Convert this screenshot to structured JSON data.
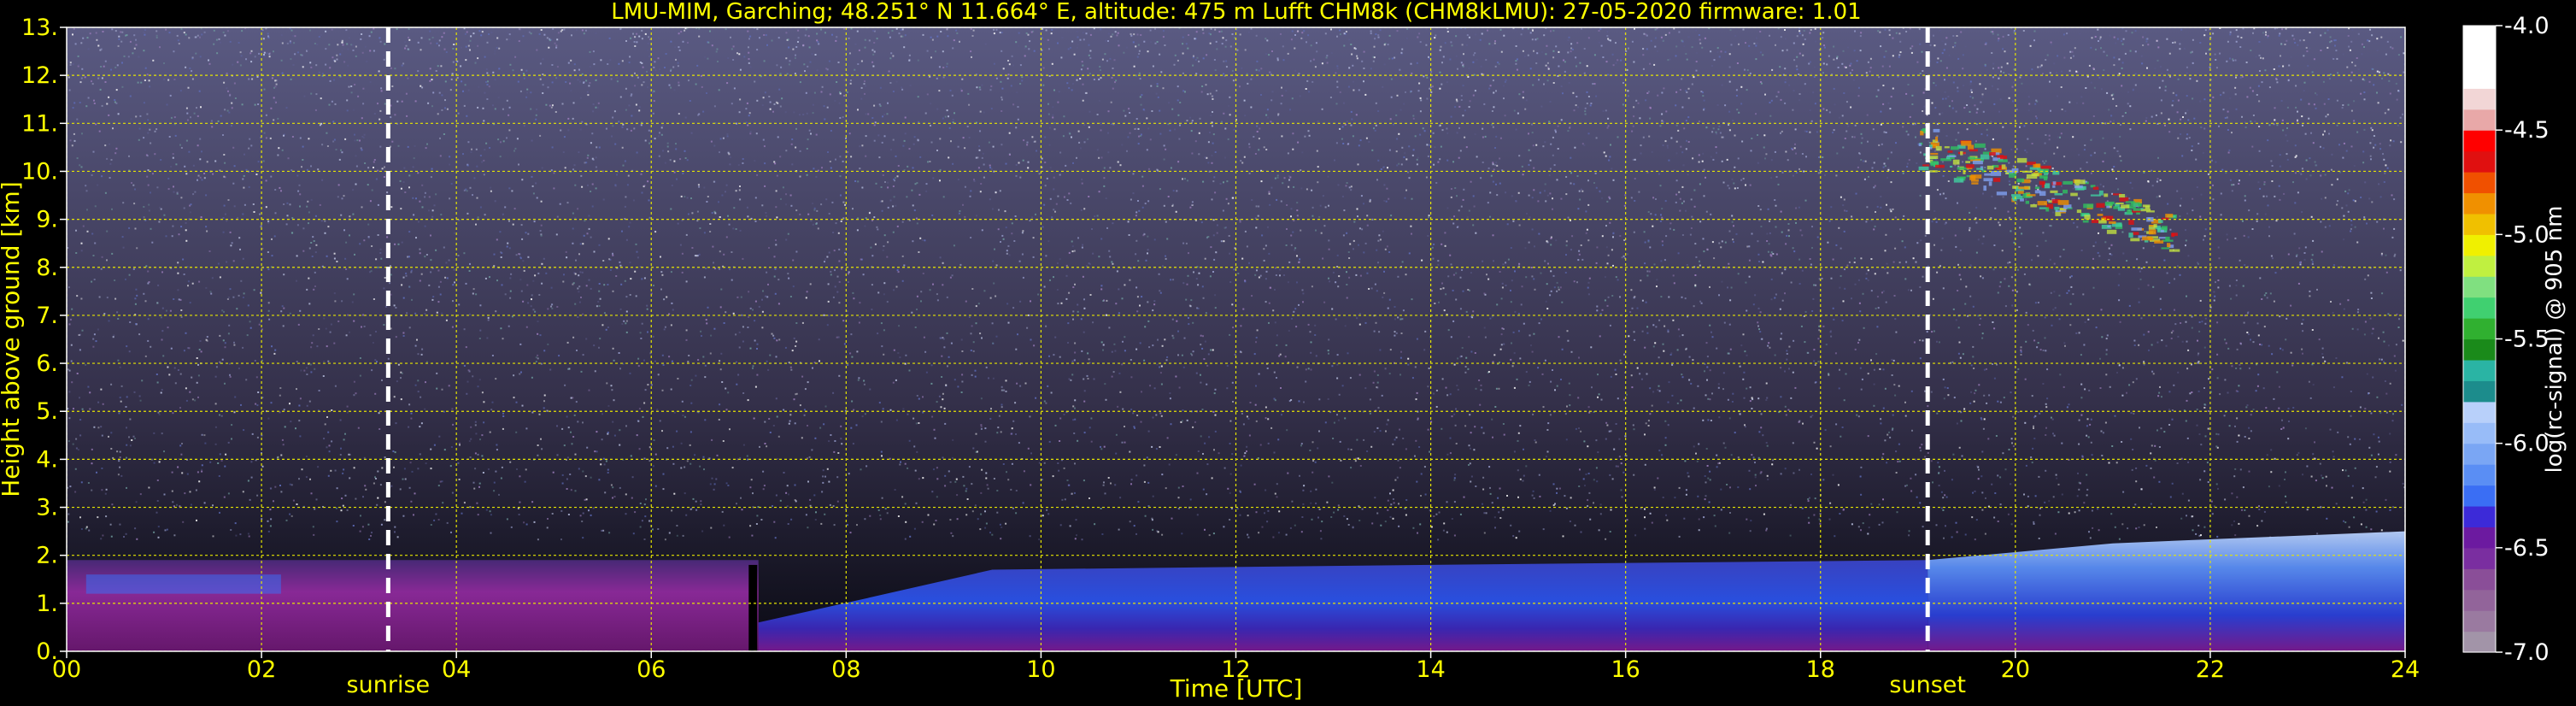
{
  "chart_data": {
    "type": "heatmap",
    "title": "LMU-MIM, Garching; 48.251° N 11.664° E, altitude: 475 m    Lufft CHM8k (CHM8kLMU): 27-05-2020    firmware: 1.01",
    "xlabel": "Time [UTC]",
    "ylabel": "Height above ground [km]",
    "xlim": [
      0,
      24
    ],
    "ylim": [
      0,
      13
    ],
    "x_ticks": [
      "00",
      "02",
      "04",
      "06",
      "08",
      "10",
      "12",
      "14",
      "16",
      "18",
      "20",
      "22",
      "24"
    ],
    "y_ticks": [
      "0.",
      "1.",
      "2.",
      "3.",
      "4.",
      "5.",
      "6.",
      "7.",
      "8.",
      "9.",
      "10.",
      "11.",
      "12.",
      "13."
    ],
    "grid": true,
    "markers": [
      {
        "label": "sunrise",
        "x": 3.3
      },
      {
        "label": "sunset",
        "x": 19.1
      }
    ],
    "colorbar": {
      "label": "log(rc-signal) @ 905 nm",
      "range": [
        -7.0,
        -4.0
      ],
      "ticks": [
        "-4.0",
        "-4.5",
        "-5.0",
        "-5.5",
        "-6.0",
        "-6.5",
        "-7.0"
      ],
      "colors": [
        "#a294a8",
        "#9a7aa0",
        "#92649a",
        "#8a4e98",
        "#7a2ea0",
        "#6c1aa0",
        "#3c2ad8",
        "#3a6ef4",
        "#5a8ef4",
        "#7aa6f4",
        "#98bcf8",
        "#b8d0fa",
        "#1c8c8c",
        "#2ab4a4",
        "#1a8a1a",
        "#30b030",
        "#40d070",
        "#80e080",
        "#c0f040",
        "#f0f000",
        "#f0c000",
        "#f09000",
        "#f05000",
        "#e01010",
        "#ff0000",
        "#e8a8a8",
        "#f2d6d6",
        "#ffffff",
        "#ffffff",
        "#ffffff"
      ]
    },
    "regions": [
      {
        "name": "boundary-layer-night",
        "x": [
          0,
          7.1
        ],
        "y": [
          0,
          1.9
        ],
        "level": -6.5
      },
      {
        "name": "boundary-layer-day",
        "x": [
          7.1,
          19.1
        ],
        "y": [
          0,
          1.8
        ],
        "level": -6.0
      },
      {
        "name": "boundary-layer-evening",
        "x": [
          19.1,
          24
        ],
        "y": [
          0,
          2.5
        ],
        "level": -6.2
      },
      {
        "name": "cirrus-cloud",
        "x": [
          19.0,
          21.6
        ],
        "y": [
          9.0,
          11.0
        ],
        "level": -5.0
      }
    ]
  }
}
